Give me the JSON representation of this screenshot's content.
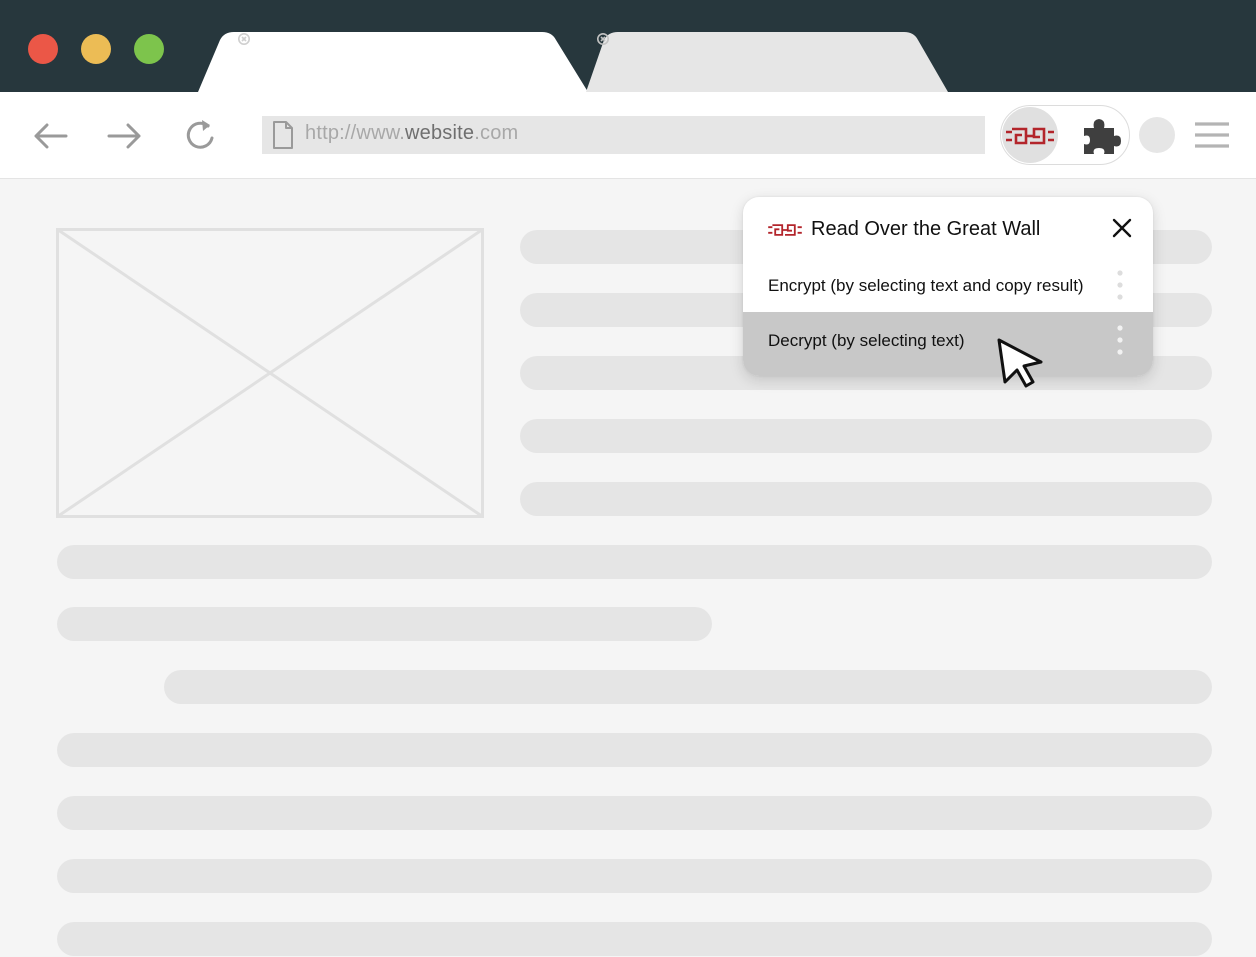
{
  "window": {
    "controls": [
      {
        "name": "close",
        "color": "#eb5747"
      },
      {
        "name": "minimize",
        "color": "#ecbc55"
      },
      {
        "name": "maximize",
        "color": "#7dc44c"
      }
    ]
  },
  "tabs": [
    {
      "title": "",
      "active": true,
      "close_icon": "close-icon"
    },
    {
      "title": "",
      "active": false,
      "close_icon": "close-icon"
    }
  ],
  "toolbar": {
    "back_icon": "arrow-left-icon",
    "forward_icon": "arrow-right-icon",
    "reload_icon": "reload-icon",
    "url": {
      "prefix": "http://www.",
      "domain": "website",
      "suffix": ".com",
      "icon": "document-icon"
    },
    "extensions": {
      "active_extension_icon": "great-wall-logo-icon",
      "extensions_icon": "puzzle-icon"
    },
    "profile_icon": "avatar",
    "menu_icon": "hamburger-menu-icon"
  },
  "popup": {
    "title": "Read Over the Great Wall",
    "logo_icon": "great-wall-logo-icon",
    "close_icon": "close-icon",
    "items": [
      {
        "label": "Encrypt (by selecting text and copy result)",
        "highlighted": false,
        "more_icon": "kebab-menu-icon"
      },
      {
        "label": "Decrypt (by selecting text)",
        "highlighted": true,
        "more_icon": "kebab-menu-icon"
      }
    ]
  },
  "colors": {
    "titlebar": "#27373d",
    "brand_red": "#b3252b",
    "page_background": "#f5f5f5",
    "skeleton": "#e5e5e5",
    "highlight": "#c8c8c8"
  }
}
